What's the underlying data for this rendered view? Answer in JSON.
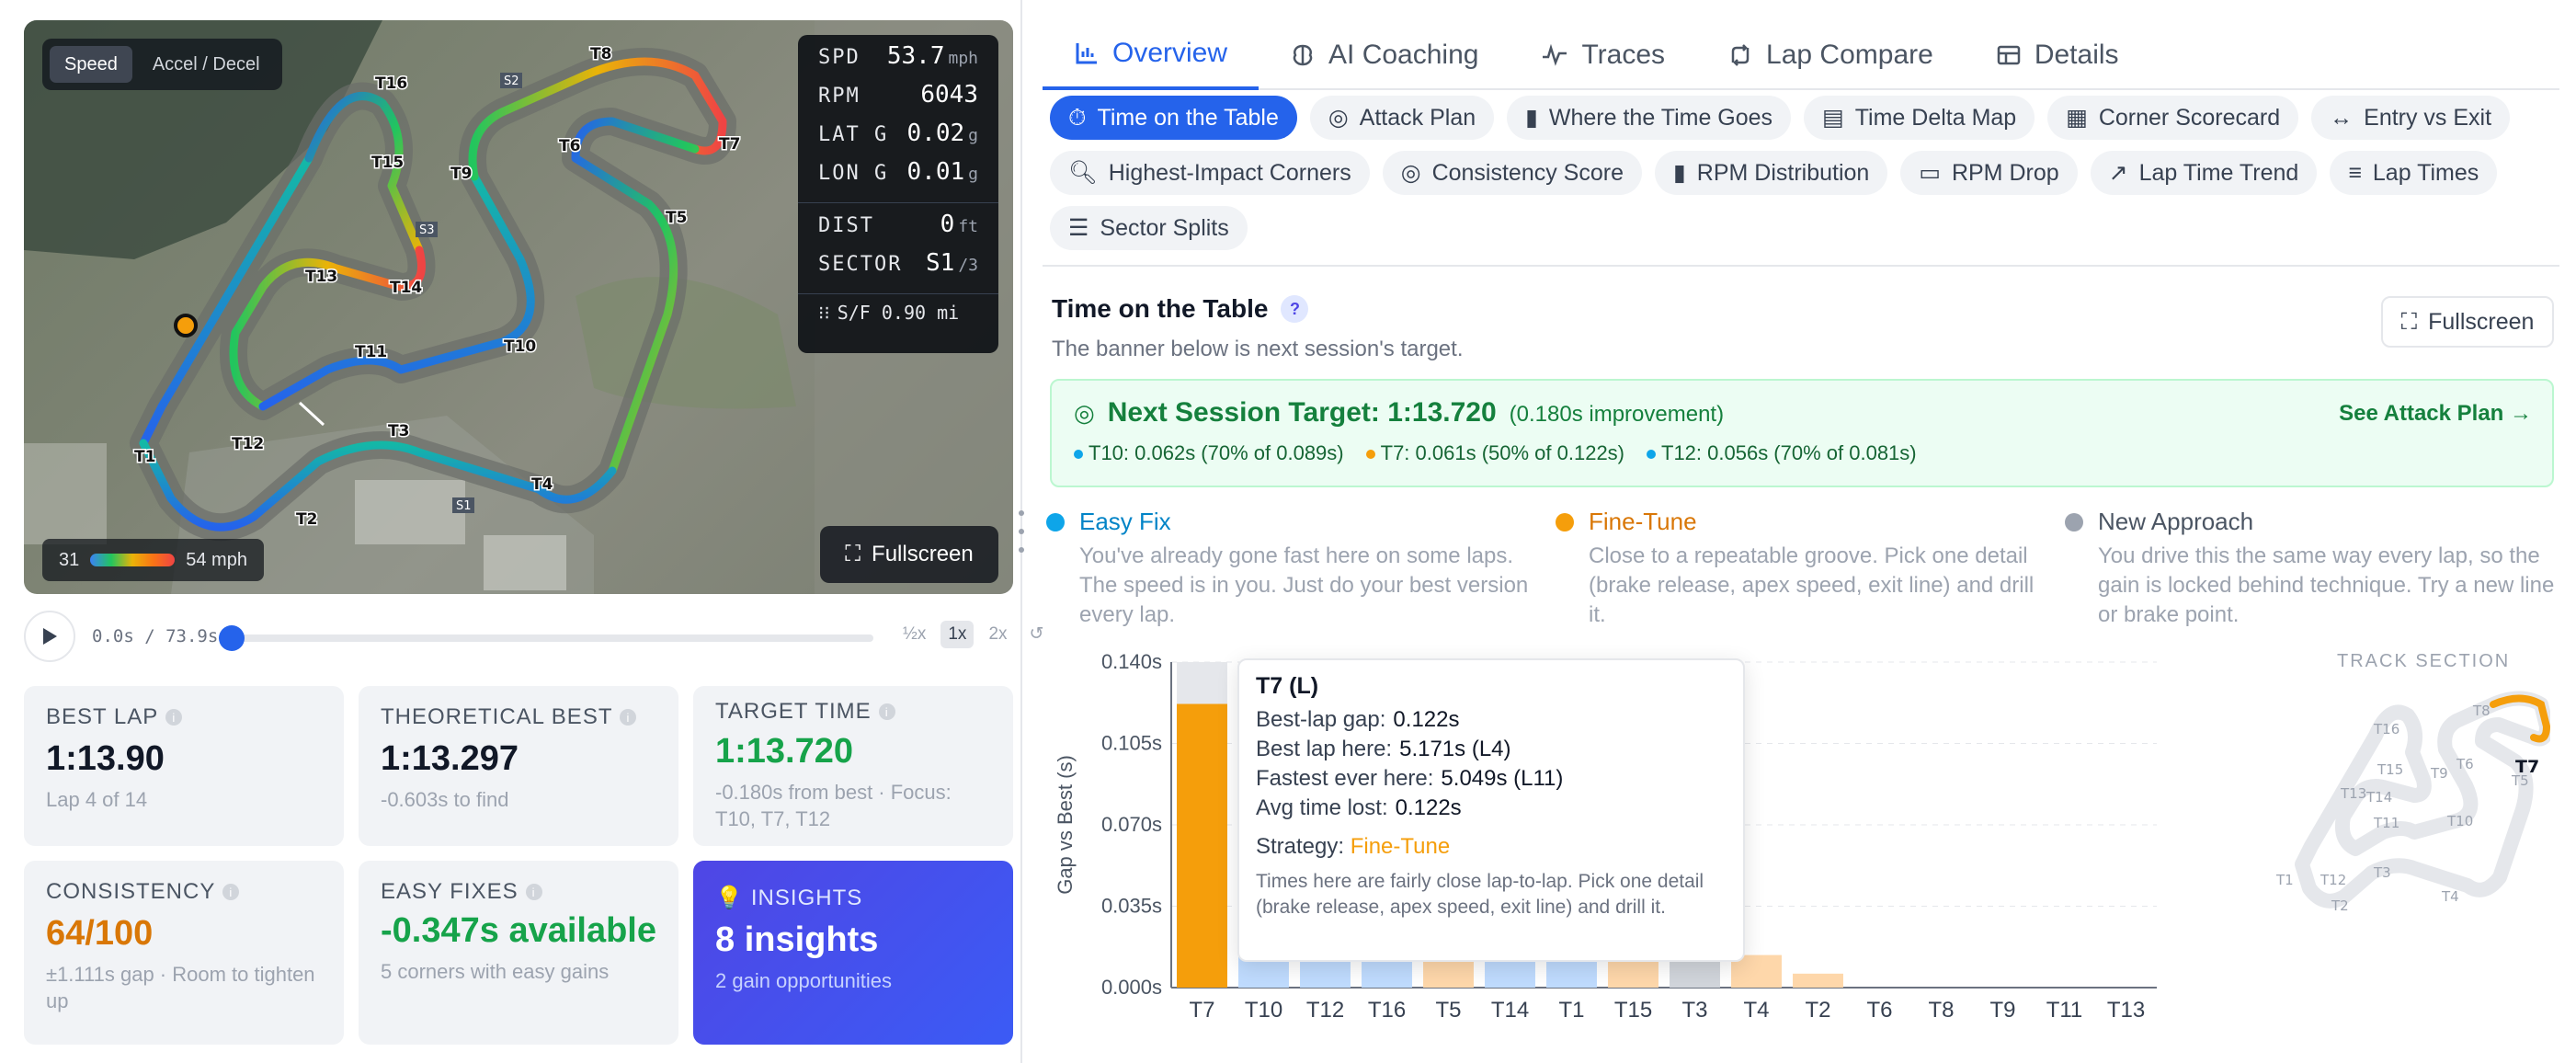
{
  "map": {
    "modes": [
      "Speed",
      "Accel / Decel"
    ],
    "telemetry": [
      {
        "label": "SPD",
        "value": "53.7",
        "unit": "mph"
      },
      {
        "label": "RPM",
        "value": "6043",
        "unit": ""
      },
      {
        "label": "LAT G",
        "value": "0.02",
        "unit": "g"
      },
      {
        "label": "LON G",
        "value": "0.01",
        "unit": "g"
      }
    ],
    "dist": {
      "label": "DIST",
      "value": "0",
      "unit": "ft"
    },
    "sector": {
      "label": "SECTOR",
      "value": "S1",
      "unit": "/3"
    },
    "sf": "S/F 0.90 mi",
    "legend_min": "31",
    "legend_max": "54 mph",
    "fullscreen": "Fullscreen",
    "corners": [
      "T1",
      "T2",
      "T3",
      "T4",
      "T5",
      "T6",
      "T7",
      "T8",
      "T9",
      "T10",
      "T11",
      "T12",
      "T13",
      "T14",
      "T15",
      "T16"
    ],
    "sectors": [
      "S1",
      "S2",
      "S3"
    ]
  },
  "player": {
    "time": "0.0s / 73.9s",
    "rates": [
      "½x",
      "1x",
      "2x"
    ],
    "progress": 0
  },
  "cards": {
    "best_lap": {
      "label": "BEST LAP",
      "value": "1:13.90",
      "sub": "Lap 4 of 14"
    },
    "theoretical": {
      "label": "THEORETICAL BEST",
      "value": "1:13.297",
      "sub": "-0.603s to find"
    },
    "target": {
      "label": "TARGET TIME",
      "value": "1:13.720",
      "sub": "-0.180s from best · Focus: T10, T7, T12"
    },
    "consistency": {
      "label": "CONSISTENCY",
      "value": "64/100",
      "sub": "±1.111s gap · Room to tighten up"
    },
    "easy": {
      "label": "EASY FIXES",
      "value": "-0.347s available",
      "sub": "5 corners with easy gains"
    },
    "insights": {
      "label": "INSIGHTS",
      "value": "8 insights",
      "sub": "2 gain opportunities"
    }
  },
  "tabs": [
    "Overview",
    "AI Coaching",
    "Traces",
    "Lap Compare",
    "Details"
  ],
  "pills": [
    "Time on the Table",
    "Attack Plan",
    "Where the Time Goes",
    "Time Delta Map",
    "Corner Scorecard",
    "Entry vs Exit",
    "Highest-Impact Corners",
    "Consistency Score",
    "RPM Distribution",
    "RPM Drop",
    "Lap Time Trend",
    "Lap Times",
    "Sector Splits"
  ],
  "section": {
    "title": "Time on the Table",
    "help": "?",
    "subtitle": "The banner below is next session's target.",
    "fullscreen": "Fullscreen"
  },
  "banner": {
    "title": "Next Session Target: 1:13.720",
    "note": "(0.180s improvement)",
    "link": "See Attack Plan →",
    "items": [
      {
        "text": "T10: 0.062s (70% of 0.089s)",
        "color": "#0ea5e9"
      },
      {
        "text": "T7: 0.061s (50% of 0.122s)",
        "color": "#f59e0b"
      },
      {
        "text": "T12: 0.056s (70% of 0.081s)",
        "color": "#0ea5e9"
      }
    ]
  },
  "strategies": [
    {
      "title": "Easy Fix",
      "color": "#0ea5e9",
      "desc": "You've already gone fast here on some laps. The speed is in you. Just do your best version every lap."
    },
    {
      "title": "Fine-Tune",
      "color": "#f59e0b",
      "desc": "Close to a repeatable groove. Pick one detail (brake release, apex speed, exit line) and drill it."
    },
    {
      "title": "New Approach",
      "color": "#9ca3af",
      "desc": "You drive this the same way every lap, so the gain is locked behind technique. Try a new line or brake point."
    }
  ],
  "chart_data": {
    "type": "bar",
    "ylabel": "Gap vs Best (s)",
    "ylim": [
      0,
      0.14
    ],
    "yticks": [
      "0.000s",
      "0.035s",
      "0.070s",
      "0.105s",
      "0.140s"
    ],
    "categories": [
      "T7",
      "T10",
      "T12",
      "T16",
      "T5",
      "T14",
      "T1",
      "T15",
      "T3",
      "T4",
      "T2",
      "T6",
      "T8",
      "T9",
      "T11",
      "T13"
    ],
    "values": [
      0.122,
      0.089,
      0.081,
      0.05,
      0.045,
      0.04,
      0.035,
      0.03,
      0.026,
      0.014,
      0.006,
      0,
      0,
      0,
      0,
      0
    ],
    "strategy": [
      "Fine-Tune",
      "Easy Fix",
      "Easy Fix",
      "Easy Fix",
      "Fine-Tune",
      "Easy Fix",
      "Easy Fix",
      "Fine-Tune",
      "New Approach",
      "Fine-Tune",
      "Fine-Tune",
      "Easy Fix",
      "Easy Fix",
      "Easy Fix",
      "Easy Fix",
      "Easy Fix"
    ],
    "colors": {
      "Easy Fix": "#bfdbfe",
      "Fine-Tune": "#fed7aa",
      "New Approach": "#d1d5db",
      "highlight": "#f59e0b"
    },
    "highlighted": "T7"
  },
  "tooltip": {
    "title": "T7 (L)",
    "rows": [
      {
        "label": "Best-lap gap:",
        "value": "0.122s"
      },
      {
        "label": "Best lap here:",
        "value": "5.171s (L4)"
      },
      {
        "label": "Fastest ever here:",
        "value": "5.049s (L11)"
      },
      {
        "label": "Avg time lost:",
        "value": "0.122s"
      }
    ],
    "strategy_label": "Strategy:",
    "strategy_value": "Fine-Tune",
    "desc": "Times here are fairly close lap-to-lap. Pick one detail (brake release, apex speed, exit line) and drill it."
  },
  "mini_map": {
    "label": "TRACK SECTION",
    "highlight": "T7"
  }
}
